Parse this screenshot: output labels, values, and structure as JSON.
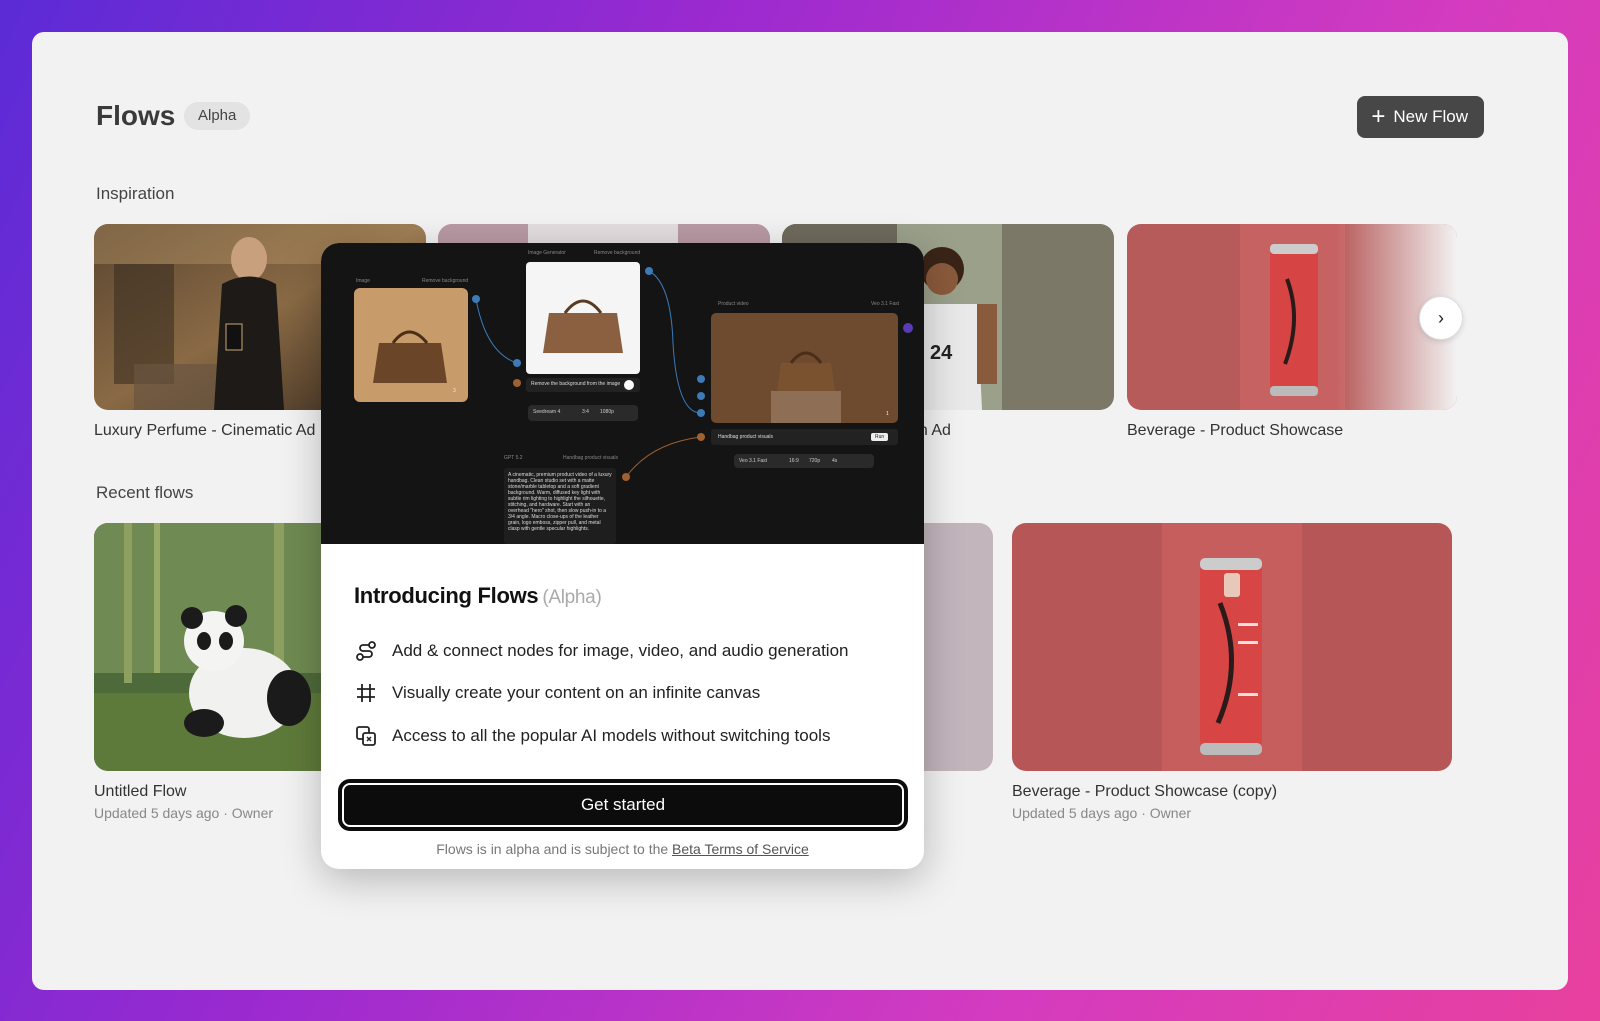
{
  "header": {
    "title": "Flows",
    "badge": "Alpha",
    "new_flow_label": "New Flow"
  },
  "inspiration": {
    "label": "Inspiration",
    "cards": [
      {
        "title": "Luxury Perfume - Cinematic Ad"
      },
      {
        "title": ""
      },
      {
        "title": "on Ad"
      },
      {
        "title": "Beverage - Product Showcase"
      }
    ]
  },
  "recent": {
    "label": "Recent flows",
    "cards": [
      {
        "title": "Untitled Flow",
        "updated": "Updated 5 days ago",
        "owner": "Owner"
      },
      {
        "title": "Beverage - Product Showcase (copy)",
        "updated": "Updated 5 days ago",
        "owner": "Owner"
      }
    ]
  },
  "modal": {
    "title": "Introducing Flows",
    "title_tag": "(Alpha)",
    "features": [
      {
        "icon": "nodes-connect-icon",
        "text": "Add & connect nodes for image, video, and audio generation"
      },
      {
        "icon": "canvas-hash-icon",
        "text": "Visually create your content on an infinite canvas"
      },
      {
        "icon": "models-copy-icon",
        "text": "Access to all the popular AI models without switching tools"
      }
    ],
    "cta": "Get started",
    "footnote_prefix": "Flows is in alpha and is subject to the",
    "footnote_link": "Beta Terms of Service",
    "hero": {
      "image_label": "Image",
      "remove_bg": "Remove background",
      "image_gen": "Image Generator",
      "remove_bg2": "Remove background",
      "prompt_small": "Remove the background from the image",
      "model": "Seedream 4",
      "ratio": "3:4",
      "res": "1080p",
      "product_video": "Product video",
      "veo_fast": "Veo 3.1 Fast",
      "handbag_prompt": "Handbag product visuals",
      "run": "Run",
      "veo_model": "Veo 3.1 Fast",
      "v_ratio": "16:9",
      "v_res": "720p",
      "v_dur": "4s",
      "gpt": "GPT 5.2",
      "gpt_out": "Handbag product visuals",
      "gpt_text": "A cinematic, premium product video of a luxury handbag. Clean studio set with a matte stone/marble tabletop and a soft gradient background. Warm, diffused key light with subtle rim lighting to highlight the silhouette, stitching, and hardware. Start with an overhead \"hero\" shot, then slow push-in to a 3/4 angle. Macro close-ups of the leather grain, logo emboss, zipper pull, and metal clasp with gentle specular highlights.",
      "count1": "3",
      "count2": "1"
    }
  },
  "colors": {
    "accent": "#474747",
    "cta": "#0c0c0c",
    "beverage": "#b85a5a"
  }
}
